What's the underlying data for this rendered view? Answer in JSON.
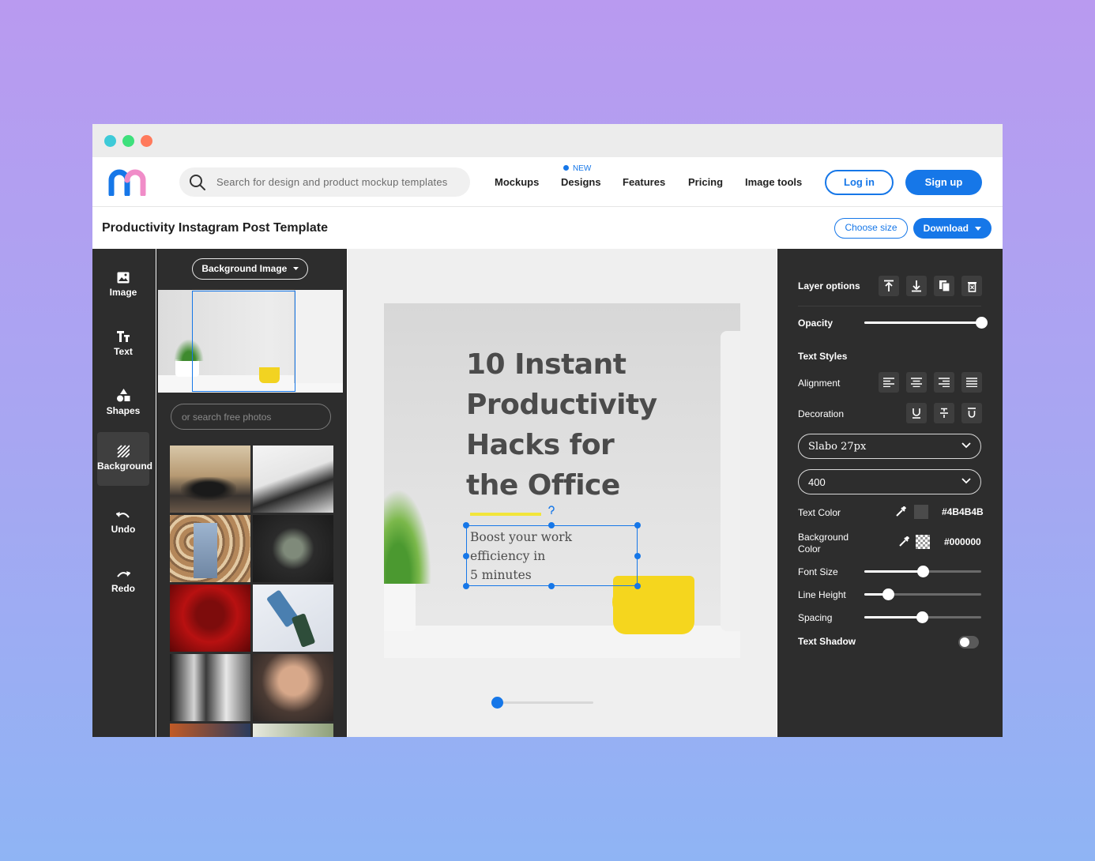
{
  "nav": {
    "search_placeholder": "Search for design and product mockup templates",
    "items": [
      "Mockups",
      "Designs",
      "Features",
      "Pricing",
      "Image tools"
    ],
    "new_badge": "NEW",
    "login": "Log in",
    "signup": "Sign up"
  },
  "subbar": {
    "title": "Productivity Instagram Post Template",
    "choose_size": "Choose size",
    "download": "Download"
  },
  "toolbar": {
    "items": [
      {
        "label": "Image",
        "icon": "image-icon"
      },
      {
        "label": "Text",
        "icon": "text-icon"
      },
      {
        "label": "Shapes",
        "icon": "shapes-icon"
      },
      {
        "label": "Background",
        "icon": "background-icon",
        "active": true
      },
      {
        "label": "Undo",
        "icon": "undo-icon"
      },
      {
        "label": "Redo",
        "icon": "redo-icon"
      }
    ]
  },
  "assets": {
    "dropdown_label": "Background Image",
    "search_placeholder": "or search free photos"
  },
  "canvas": {
    "headline_lines": [
      "10 Instant",
      "Productivity",
      "Hacks for",
      "the Office"
    ],
    "subtext_lines": [
      "Boost your work",
      "efficiency in",
      "5 minutes"
    ],
    "zoom_level": 0.05
  },
  "props": {
    "layer_options": "Layer options",
    "opacity": "Opacity",
    "opacity_value": 1.0,
    "text_styles": "Text Styles",
    "alignment": "Alignment",
    "decoration": "Decoration",
    "font": "Slabo 27px",
    "weight": "400",
    "text_color_label": "Text Color",
    "text_color": "#4B4B4B",
    "bg_color_label_1": "Background",
    "bg_color_label_2": "Color",
    "bg_color": "#000000",
    "font_size_label": "Font Size",
    "font_size_value": 0.5,
    "line_height_label": "Line Height",
    "line_height_value": 0.2,
    "spacing_label": "Spacing",
    "spacing_value": 0.49,
    "text_shadow_label": "Text Shadow",
    "text_shadow_on": false
  },
  "colors": {
    "accent": "#1677e8",
    "panel": "#2d2d2d",
    "dot_teal": "#3ecad8",
    "dot_green": "#3ee07c",
    "dot_red": "#ff7a5c"
  }
}
